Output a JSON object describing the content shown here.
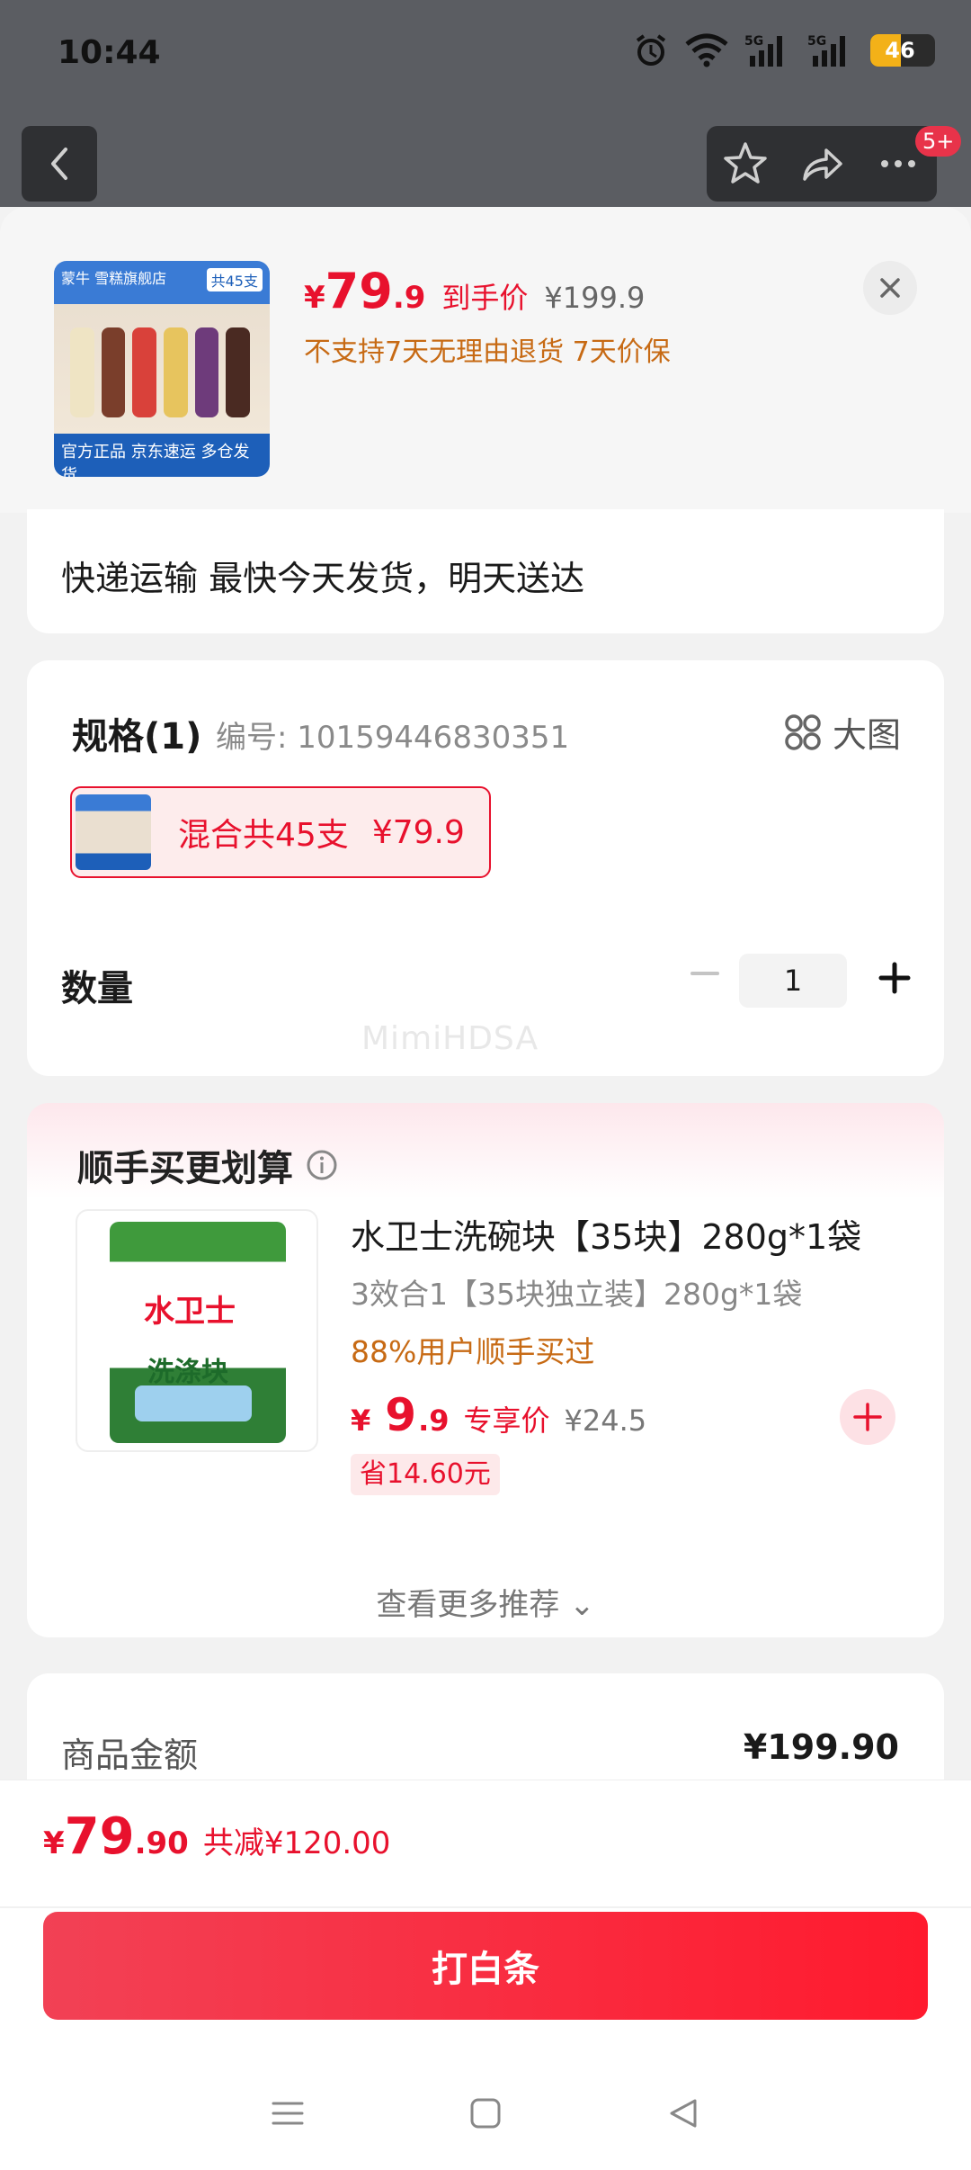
{
  "status": {
    "time": "10:44",
    "battery": "46",
    "signal_label": "5G"
  },
  "nav": {
    "badge": "5+"
  },
  "product": {
    "thumb_store": "蒙牛 雪糕旗舰店",
    "thumb_tag": "共45支",
    "thumb_bottom": "官方正品  京东速运 多仓发货",
    "price_currency": "¥",
    "price_int": "79",
    "price_dec": ".9",
    "price_tag": "到手价",
    "original_price": "¥199.9",
    "policy": "不支持7天无理由退货  7天价保"
  },
  "delivery": {
    "text": "快递运输 最快今天发货，明天送达"
  },
  "spec": {
    "title": "规格(1)",
    "code": "编号: 10159446830351",
    "big_image": "大图",
    "option_label": "混合共45支",
    "option_price": "¥79.9",
    "quantity_label": "数量",
    "quantity_value": "1",
    "watermark": "MimiHDSA"
  },
  "upsell": {
    "title": "顺手买更划算",
    "product_brand": "水卫士",
    "product_brand2": "洗涤块",
    "product_name": "水卫士洗碗块【35块】280g*1袋",
    "product_sub": "3效合1【35块独立装】280g*1袋",
    "hint": "88%用户顺手买过",
    "price_currency": "¥",
    "price_int": "9",
    "price_dec": ".9",
    "price_tag": "专享价",
    "original_price": "¥24.5",
    "save": "省14.60元",
    "more": "查看更多推荐 ⌄"
  },
  "summary": {
    "label": "商品金额",
    "value": "¥199.90"
  },
  "checkout": {
    "currency": "¥",
    "total_int": "79",
    "total_dec": ".90",
    "reduce": "共减¥120.00",
    "button": "打白条"
  },
  "colors": {
    "accent": "#e8112d",
    "orange_text": "#c76a14"
  }
}
